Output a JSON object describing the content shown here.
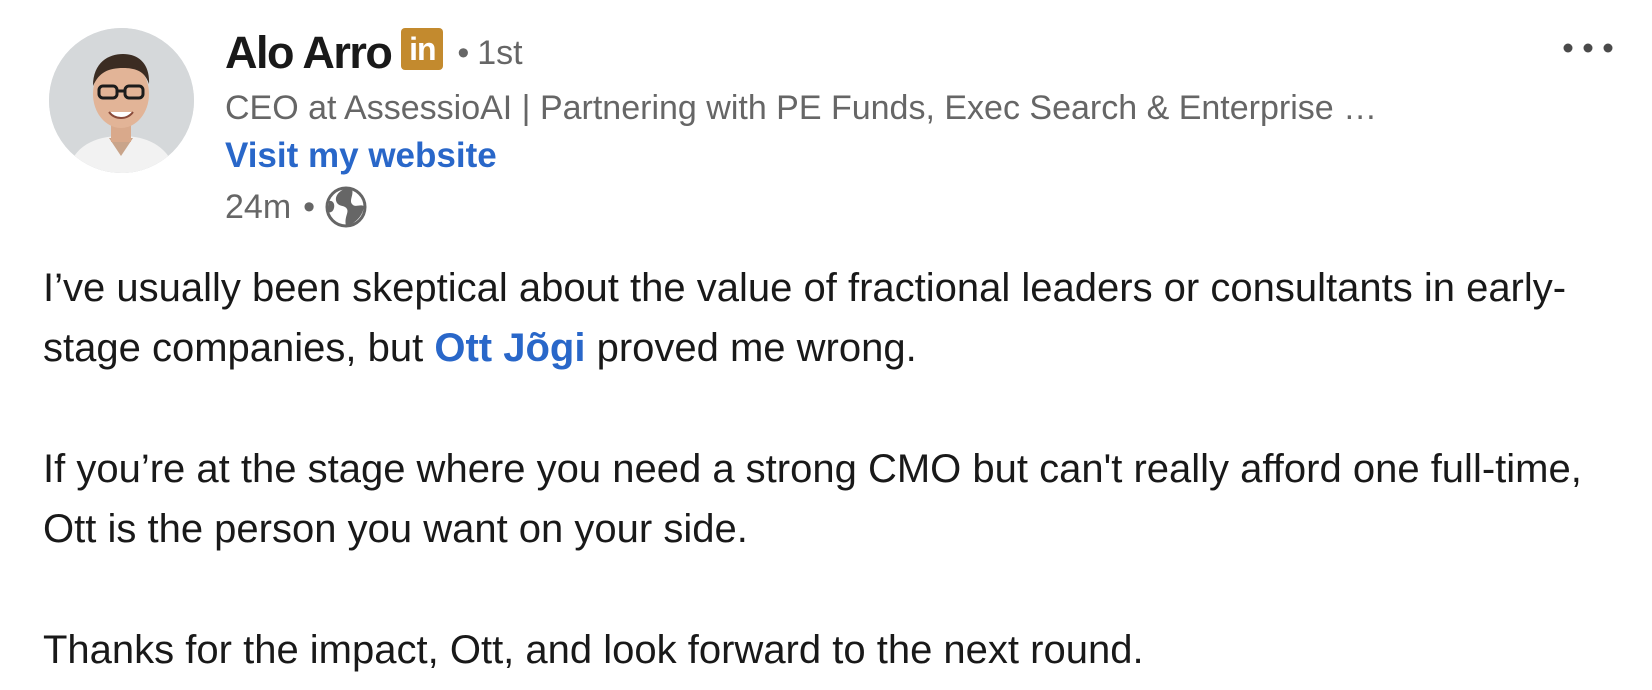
{
  "author": {
    "name": "Alo Arro",
    "badge_text": "in",
    "degree_separator": "•",
    "degree": "1st",
    "headline": "CEO at AssessioAI | Partnering with PE Funds, Exec Search & Enterprise …",
    "website_link": "Visit my website"
  },
  "meta": {
    "time": "24m",
    "separator": "•",
    "visibility_icon": "globe-icon"
  },
  "menu": {
    "icon": "more-horizontal-icon"
  },
  "post": {
    "p1_before": "I’ve usually been skeptical about the value of fractional leaders or consultants in early-stage companies, but ",
    "p1_mention": "Ott Jõgi",
    "p1_after": " proved me wrong.",
    "p2": "If you’re at the stage where you need a strong CMO but can't really afford one full-time, Ott is the person you want on your side.",
    "p3": "Thanks for the impact, Ott, and look forward to the next round."
  },
  "colors": {
    "link_blue": "#2967c9",
    "secondary_text": "#666666",
    "primary_text": "#191919",
    "badge_gold": "#c38a2e"
  }
}
